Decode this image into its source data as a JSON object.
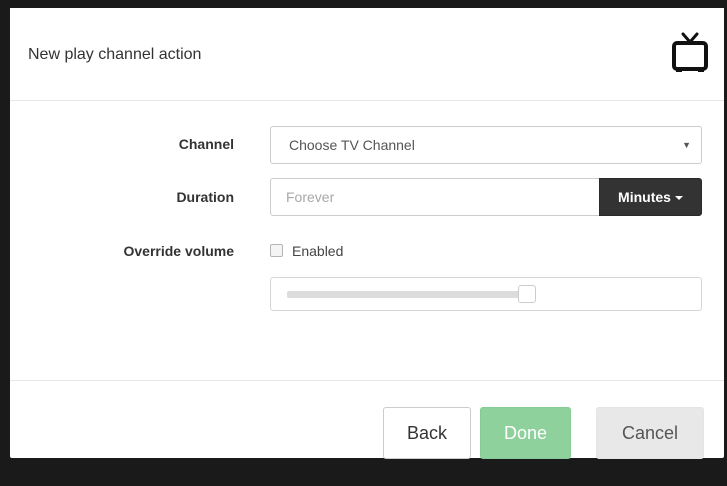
{
  "modal": {
    "title": "New play channel action",
    "icon": "tv-icon"
  },
  "form": {
    "channel": {
      "label": "Channel",
      "selected": "Choose TV Channel"
    },
    "duration": {
      "label": "Duration",
      "placeholder": "Forever",
      "value": "",
      "units": "Minutes"
    },
    "override_volume": {
      "label": "Override volume",
      "checkbox_label": "Enabled",
      "checked": false,
      "volume_level": 0.58
    }
  },
  "footer": {
    "back_label": "Back",
    "done_label": "Done",
    "cancel_label": "Cancel"
  },
  "colors": {
    "done_button": "#8ed19d",
    "units_button": "#333333",
    "cancel_button": "#e8e8e8"
  }
}
